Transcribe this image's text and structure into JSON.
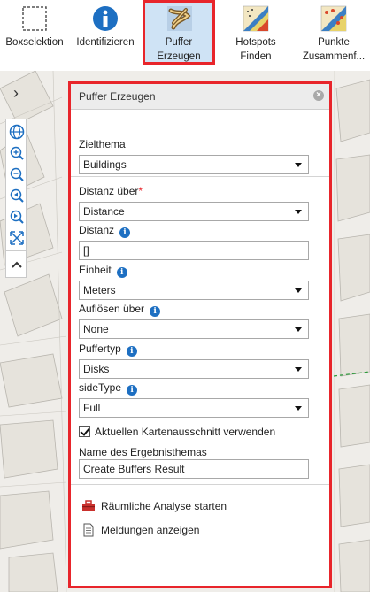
{
  "toolbar": {
    "items": [
      {
        "label": "Boxselektion",
        "icon": "box-selection-icon",
        "active": false
      },
      {
        "label": "Identifizieren",
        "icon": "info-icon",
        "active": false
      },
      {
        "label": "Puffer\nErzeugen",
        "label_line1": "Puffer",
        "label_line2": "Erzeugen",
        "icon": "buffer-icon",
        "active": true
      },
      {
        "label_line1": "Hotspots",
        "label_line2": "Finden",
        "icon": "hotspot-icon",
        "active": false
      },
      {
        "label_line1": "Punkte",
        "label_line2": "Zusammenf...",
        "icon": "aggregate-points-icon",
        "active": false
      }
    ]
  },
  "panel": {
    "title": "Puffer Erzeugen",
    "fields": {
      "zielthema": {
        "label": "Zielthema",
        "value": "Buildings"
      },
      "distanz_ueber": {
        "label": "Distanz über",
        "required": "*",
        "value": "Distance"
      },
      "distanz": {
        "label": "Distanz",
        "value": "[]"
      },
      "einheit": {
        "label": "Einheit",
        "value": "Meters"
      },
      "aufloesen": {
        "label": "Auflösen über",
        "value": "None"
      },
      "puffertyp": {
        "label": "Puffertyp",
        "value": "Disks"
      },
      "sidetype": {
        "label": "sideType",
        "value": "Full"
      },
      "extent": {
        "label": "Aktuellen Kartenausschnitt verwenden",
        "checked": true
      },
      "result_name": {
        "label": "Name des Ergebnisthemas",
        "value": "Create Buffers Result"
      }
    },
    "actions": {
      "start": "Räumliche Analyse starten",
      "messages": "Meldungen anzeigen"
    }
  },
  "colors": {
    "highlight": "#e8252b",
    "active_tool_bg": "#cfe3f5",
    "info_blue": "#1d6fc2"
  }
}
